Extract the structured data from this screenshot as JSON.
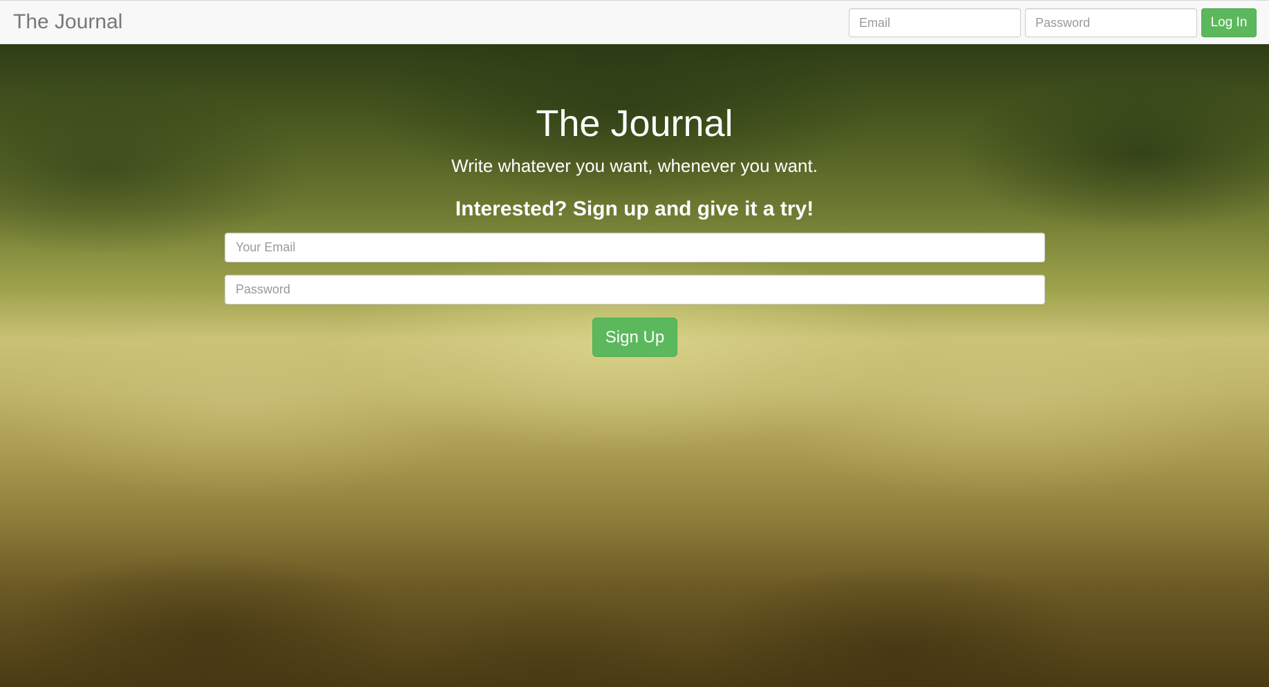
{
  "navbar": {
    "brand": "The Journal",
    "email_placeholder": "Email",
    "password_placeholder": "Password",
    "login_label": "Log In"
  },
  "hero": {
    "title": "The Journal",
    "tagline": "Write whatever you want, whenever you want.",
    "cta": "Interested? Sign up and give it a try!"
  },
  "signup": {
    "email_placeholder": "Your Email",
    "password_placeholder": "Password",
    "button_label": "Sign Up"
  },
  "colors": {
    "accent_green": "#5cb85c",
    "navbar_bg": "#f8f8f8",
    "brand_text": "#777777"
  }
}
